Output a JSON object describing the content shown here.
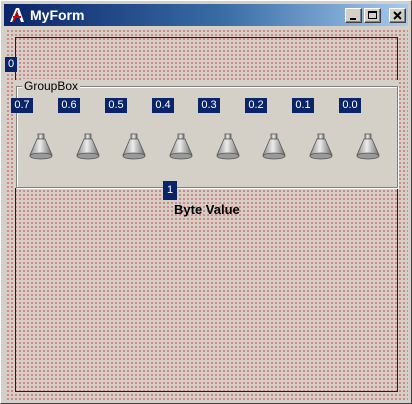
{
  "window": {
    "title": "MyForm",
    "controls": {
      "minimize": "minimize-icon",
      "maximize": "maximize-icon",
      "close": "close-icon"
    }
  },
  "form": {
    "tag": "0",
    "groupbox": {
      "title": "GroupBox",
      "bits": [
        {
          "label": "0.7",
          "icon": "lamp-icon"
        },
        {
          "label": "0.6",
          "icon": "lamp-icon"
        },
        {
          "label": "0.5",
          "icon": "lamp-icon"
        },
        {
          "label": "0.4",
          "icon": "lamp-icon"
        },
        {
          "label": "0.3",
          "icon": "lamp-icon"
        },
        {
          "label": "0.2",
          "icon": "lamp-icon"
        },
        {
          "label": "0.1",
          "icon": "lamp-icon"
        },
        {
          "label": "0.0",
          "icon": "lamp-icon"
        }
      ]
    },
    "value_tag": "1",
    "value_label": "Byte Value"
  },
  "colors": {
    "title_gradient_start": "#0a246a",
    "title_gradient_end": "#a6caf0",
    "tag_background": "#0a246a",
    "grid_dots": "#c8343c",
    "frame_line": "#0000ff"
  }
}
